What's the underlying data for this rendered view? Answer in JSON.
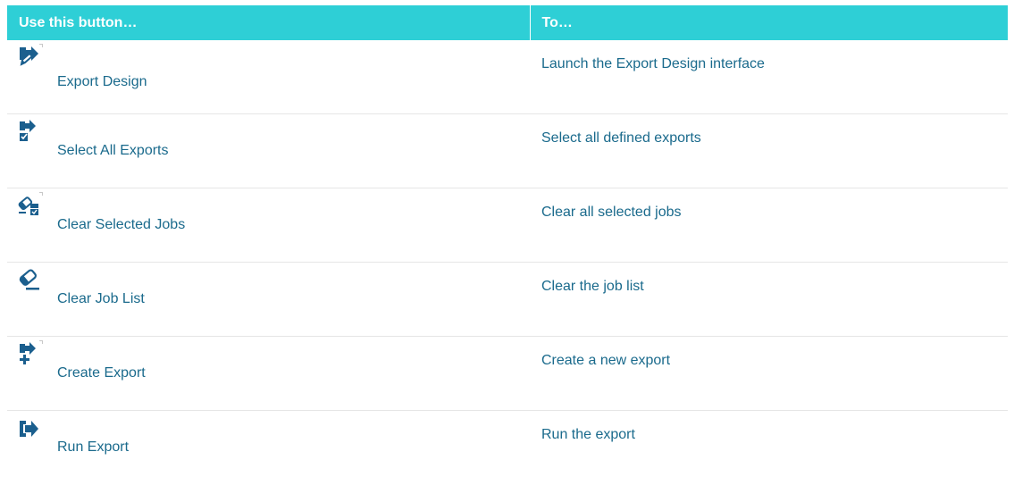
{
  "header": {
    "col1": "Use this button…",
    "col2": "To…"
  },
  "colors": {
    "header_bg": "#2ecfd6",
    "text": "#1a6a8c",
    "icon_blue": "#1b5f8e"
  },
  "rows": [
    {
      "icon": "export-design-icon",
      "button": "Export Design",
      "description": "Launch the Export Design interface"
    },
    {
      "icon": "select-all-exports-icon",
      "button": "Select All Exports",
      "description": "Select all defined exports"
    },
    {
      "icon": "clear-selected-jobs-icon",
      "button": "Clear Selected Jobs",
      "description": "Clear all selected jobs"
    },
    {
      "icon": "clear-job-list-icon",
      "button": "Clear Job List",
      "description": "Clear the job list"
    },
    {
      "icon": "create-export-icon",
      "button": "Create Export",
      "description": "Create a new export"
    },
    {
      "icon": "run-export-icon",
      "button": "Run Export",
      "description": "Run the export"
    }
  ]
}
